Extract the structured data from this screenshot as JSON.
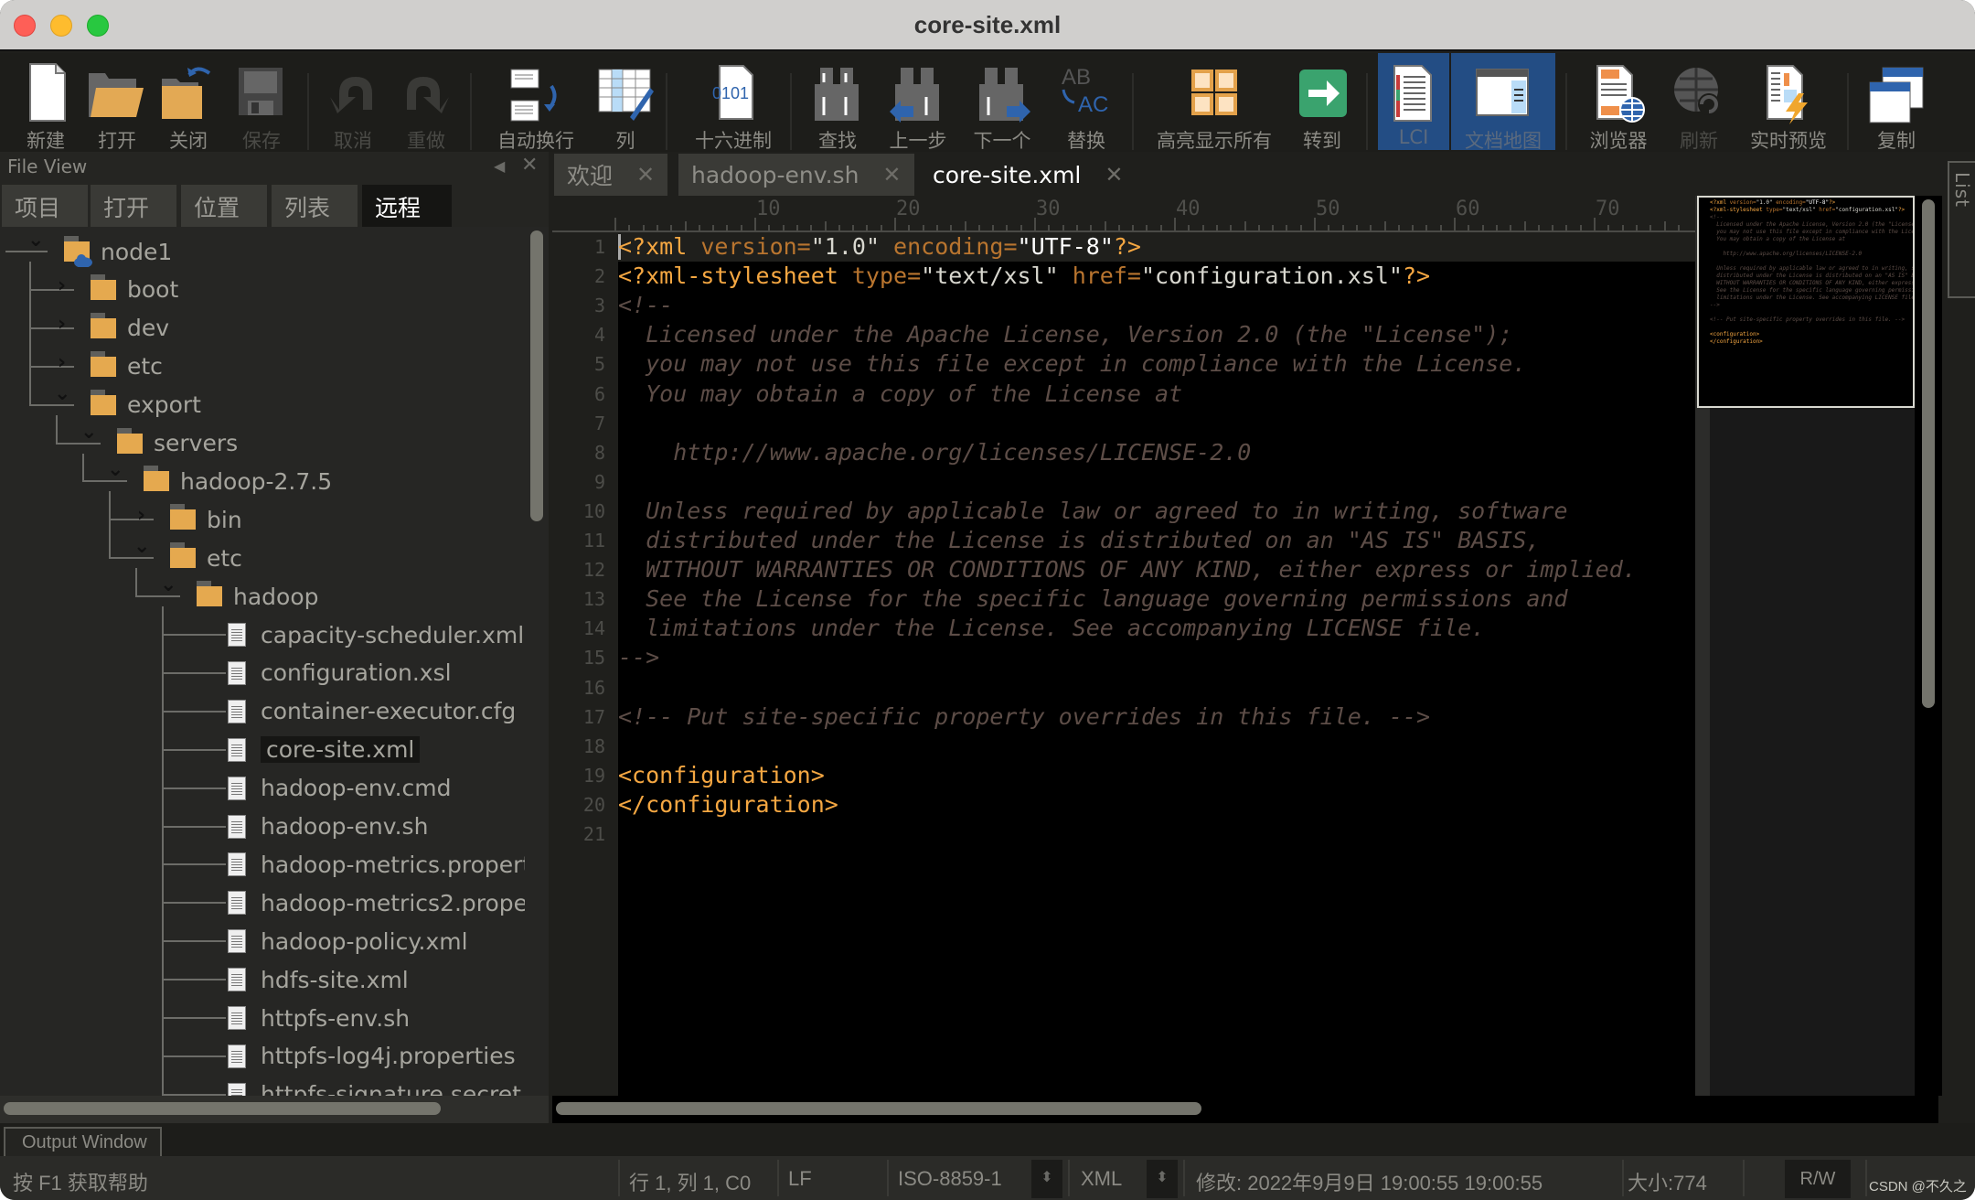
{
  "window": {
    "title": "core-site.xml"
  },
  "toolbar": {
    "buttons": [
      {
        "id": "new",
        "label": "新建",
        "icon": "new-file-icon",
        "enabled": true
      },
      {
        "id": "open",
        "label": "打开",
        "icon": "open-folder-icon",
        "enabled": true
      },
      {
        "id": "close",
        "label": "关闭",
        "icon": "close-folder-icon",
        "enabled": true
      },
      {
        "id": "save",
        "label": "保存",
        "icon": "save-disk-icon",
        "enabled": false
      },
      {
        "id": "undo",
        "label": "取消",
        "icon": "undo-icon",
        "enabled": false
      },
      {
        "id": "redo",
        "label": "重做",
        "icon": "redo-icon",
        "enabled": false
      },
      {
        "id": "wrap",
        "label": "自动换行",
        "icon": "word-wrap-icon",
        "enabled": true
      },
      {
        "id": "column",
        "label": "列",
        "icon": "column-edit-icon",
        "enabled": true
      },
      {
        "id": "hex",
        "label": "十六进制",
        "icon": "hex-file-icon",
        "enabled": true,
        "icon_text": "0101"
      },
      {
        "id": "find",
        "label": "查找",
        "icon": "binoculars-icon",
        "enabled": true
      },
      {
        "id": "prev",
        "label": "上一步",
        "icon": "find-previous-icon",
        "enabled": true
      },
      {
        "id": "next",
        "label": "下一个",
        "icon": "find-next-icon",
        "enabled": true
      },
      {
        "id": "replace",
        "label": "替换",
        "icon": "replace-icon",
        "enabled": true,
        "icon_text_top": "AB",
        "icon_text_bottom": "AC"
      },
      {
        "id": "highlight",
        "label": "高亮显示所有",
        "icon": "highlight-all-icon",
        "enabled": true
      },
      {
        "id": "goto",
        "label": "转到",
        "icon": "goto-arrow-icon",
        "enabled": true
      },
      {
        "id": "lci",
        "label": "LCI",
        "icon": "lci-document-icon",
        "enabled": true,
        "active": true
      },
      {
        "id": "docmap",
        "label": "文档地图",
        "icon": "document-map-icon",
        "enabled": true,
        "active": true
      },
      {
        "id": "browser",
        "label": "浏览器",
        "icon": "browser-globe-icon",
        "enabled": true
      },
      {
        "id": "refresh",
        "label": "刷新",
        "icon": "refresh-globe-icon",
        "enabled": false
      },
      {
        "id": "preview",
        "label": "实时预览",
        "icon": "live-preview-icon",
        "enabled": true
      },
      {
        "id": "copy",
        "label": "复制",
        "icon": "copy-window-icon",
        "enabled": true
      }
    ]
  },
  "file_view": {
    "title": "File View",
    "tabs": [
      {
        "label": "项目",
        "active": false
      },
      {
        "label": "打开",
        "active": false
      },
      {
        "label": "位置",
        "active": false
      },
      {
        "label": "列表",
        "active": false
      },
      {
        "label": "远程",
        "active": true
      }
    ],
    "tree": [
      {
        "name": "node1",
        "type": "server",
        "depth": 0,
        "expanded": true
      },
      {
        "name": "boot",
        "type": "folder",
        "depth": 1,
        "expanded": false
      },
      {
        "name": "dev",
        "type": "folder",
        "depth": 1,
        "expanded": false
      },
      {
        "name": "etc",
        "type": "folder",
        "depth": 1,
        "expanded": false
      },
      {
        "name": "export",
        "type": "folder",
        "depth": 1,
        "expanded": true
      },
      {
        "name": "servers",
        "type": "folder",
        "depth": 2,
        "expanded": true
      },
      {
        "name": "hadoop-2.7.5",
        "type": "folder",
        "depth": 3,
        "expanded": true
      },
      {
        "name": "bin",
        "type": "folder",
        "depth": 4,
        "expanded": false
      },
      {
        "name": "etc",
        "type": "folder",
        "depth": 4,
        "expanded": true
      },
      {
        "name": "hadoop",
        "type": "folder",
        "depth": 5,
        "expanded": true
      },
      {
        "name": "capacity-scheduler.xml",
        "type": "file",
        "depth": 6
      },
      {
        "name": "configuration.xsl",
        "type": "file",
        "depth": 6
      },
      {
        "name": "container-executor.cfg",
        "type": "file",
        "depth": 6
      },
      {
        "name": "core-site.xml",
        "type": "file",
        "depth": 6,
        "selected": true
      },
      {
        "name": "hadoop-env.cmd",
        "type": "file",
        "depth": 6
      },
      {
        "name": "hadoop-env.sh",
        "type": "file",
        "depth": 6
      },
      {
        "name": "hadoop-metrics.propert",
        "type": "file",
        "depth": 6
      },
      {
        "name": "hadoop-metrics2.proper",
        "type": "file",
        "depth": 6
      },
      {
        "name": "hadoop-policy.xml",
        "type": "file",
        "depth": 6
      },
      {
        "name": "hdfs-site.xml",
        "type": "file",
        "depth": 6
      },
      {
        "name": "httpfs-env.sh",
        "type": "file",
        "depth": 6
      },
      {
        "name": "httpfs-log4j.properties",
        "type": "file",
        "depth": 6
      },
      {
        "name": "httpfs-signature.secret",
        "type": "file",
        "depth": 6
      }
    ]
  },
  "editor": {
    "tabs": [
      {
        "label": "欢迎",
        "active": false
      },
      {
        "label": "hadoop-env.sh",
        "active": false
      },
      {
        "label": "core-site.xml",
        "active": true
      }
    ],
    "ruler_marks": [
      "10",
      "20",
      "30",
      "40",
      "50",
      "60",
      "70"
    ],
    "lines": [
      [
        [
          "punc",
          "<?xml"
        ],
        [
          "attr",
          " version="
        ],
        [
          "val",
          "\"1.0\""
        ],
        [
          "attr",
          " encoding="
        ],
        [
          "str",
          "\"UTF-8\""
        ],
        [
          "punc",
          "?>"
        ]
      ],
      [
        [
          "punc",
          "<?xml-stylesheet"
        ],
        [
          "attr",
          " type="
        ],
        [
          "val",
          "\"text/xsl\""
        ],
        [
          "attr",
          " href="
        ],
        [
          "val",
          "\"configuration.xsl\""
        ],
        [
          "punc",
          "?>"
        ]
      ],
      [
        [
          "com",
          "<!--"
        ]
      ],
      [
        [
          "com",
          "  Licensed under the Apache License, Version 2.0 (the \"License\");"
        ]
      ],
      [
        [
          "com",
          "  you may not use this file except in compliance with the License."
        ]
      ],
      [
        [
          "com",
          "  You may obtain a copy of the License at"
        ]
      ],
      [
        [
          "com",
          ""
        ]
      ],
      [
        [
          "com",
          "    http://www.apache.org/licenses/LICENSE-2.0"
        ]
      ],
      [
        [
          "com",
          ""
        ]
      ],
      [
        [
          "com",
          "  Unless required by applicable law or agreed to in writing, software"
        ]
      ],
      [
        [
          "com",
          "  distributed under the License is distributed on an \"AS IS\" BASIS,"
        ]
      ],
      [
        [
          "com",
          "  WITHOUT WARRANTIES OR CONDITIONS OF ANY KIND, either express or implied."
        ]
      ],
      [
        [
          "com",
          "  See the License for the specific language governing permissions and"
        ]
      ],
      [
        [
          "com",
          "  limitations under the License. See accompanying LICENSE file."
        ]
      ],
      [
        [
          "com",
          "-->"
        ]
      ],
      [
        [
          "com",
          ""
        ]
      ],
      [
        [
          "com",
          "<!-- Put site-specific property overrides in this file. -->"
        ]
      ],
      [
        [
          "com",
          ""
        ]
      ],
      [
        [
          "tag",
          "<configuration>"
        ]
      ],
      [
        [
          "tag",
          "</configuration>"
        ]
      ],
      [
        [
          "com",
          ""
        ]
      ]
    ]
  },
  "function_list": {
    "label": "Function List"
  },
  "output_window": {
    "label": "Output Window"
  },
  "status": {
    "help": "按 F1 获取帮助",
    "position": "行 1, 列 1, C0",
    "line_ending": "LF",
    "encoding": "ISO-8859-1",
    "syntax": "XML",
    "modified": "修改:  2022年9月9日 19:00:55 19:00:55",
    "size": "大小:774",
    "mode": "R/W",
    "watermark": "CSDN @不久之"
  },
  "colors": {
    "tag": "#f5a742",
    "attribute": "#b9752f",
    "comment": "#5d4d47",
    "string": "#ffffff",
    "folder": "#e5a94f",
    "active_tool": "#234d84"
  }
}
